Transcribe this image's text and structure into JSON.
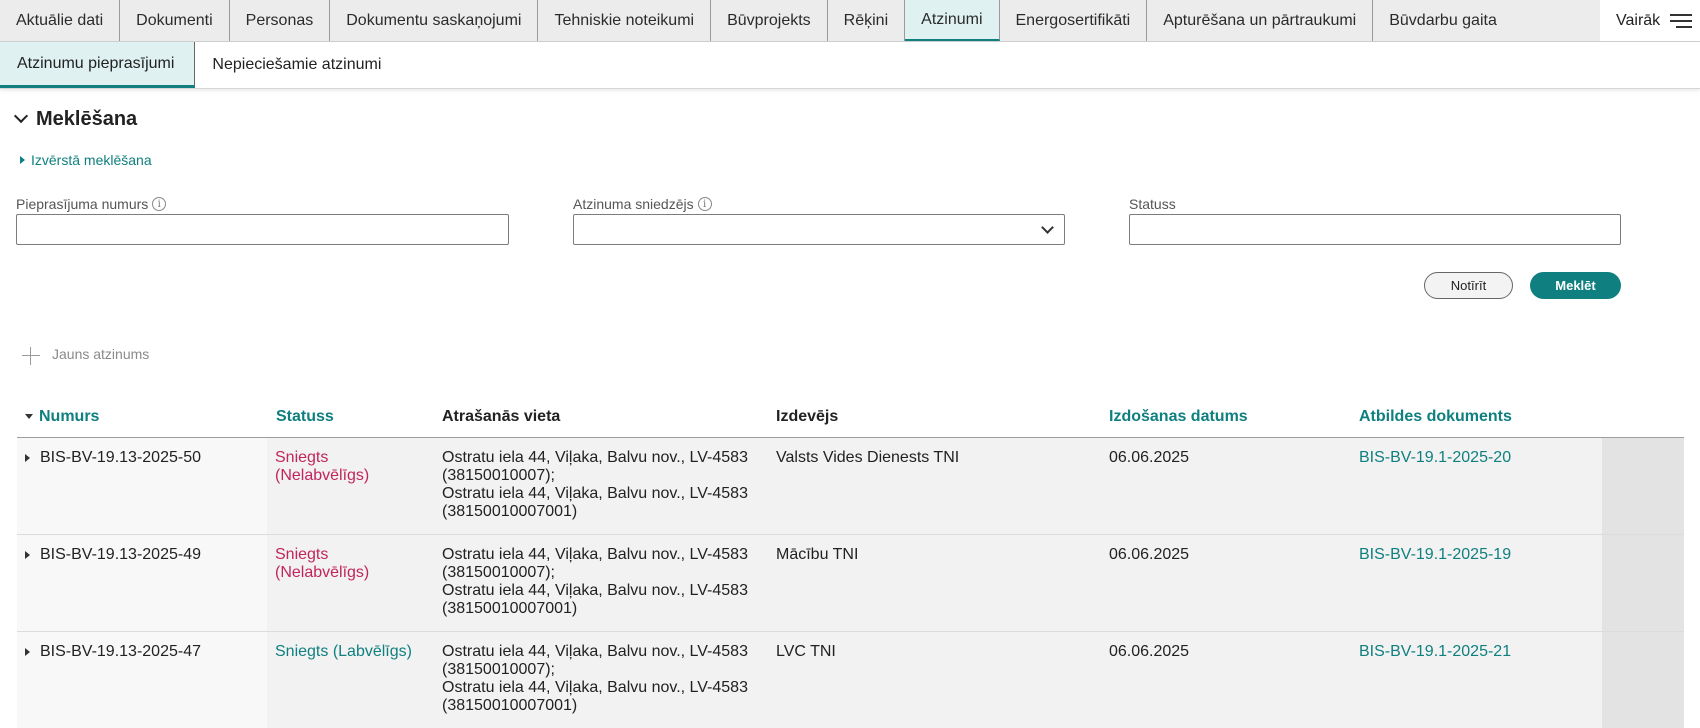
{
  "top_tabs": [
    {
      "label": "Aktuālie dati"
    },
    {
      "label": "Dokumenti"
    },
    {
      "label": "Personas"
    },
    {
      "label": "Dokumentu saskaņojumi"
    },
    {
      "label": "Tehniskie noteikumi"
    },
    {
      "label": "Būvprojekts"
    },
    {
      "label": "Rēķini"
    },
    {
      "label": "Atzinumi",
      "active": true
    },
    {
      "label": "Energosertifikāti"
    },
    {
      "label": "Apturēšana un pārtraukumi"
    },
    {
      "label": "Būvdarbu gaita"
    }
  ],
  "more_label": "Vairāk",
  "sub_tabs": [
    {
      "label": "Atzinumu pieprasījumi",
      "active": true
    },
    {
      "label": "Nepieciešamie atzinumi"
    }
  ],
  "search": {
    "title": "Meklēšana",
    "advanced_label": "Izvērstā meklēšana",
    "fields": {
      "request_number_label": "Pieprasījuma numurs",
      "issuer_label": "Atzinuma sniedzējs",
      "status_label": "Statuss"
    },
    "clear_label": "Notīrīt",
    "search_label": "Meklēt"
  },
  "new_label": "Jauns atzinums",
  "table": {
    "headers": {
      "number": "Numurs",
      "status": "Statuss",
      "location": "Atrašanās vieta",
      "issuer": "Izdevējs",
      "issue_date": "Izdošanas datums",
      "response_doc": "Atbildes dokuments"
    },
    "rows": [
      {
        "number": "BIS-BV-19.13-2025-50",
        "status_line1": "Sniegts",
        "status_line2": "(Nelabvēlīgs)",
        "location": [
          "Ostratu iela 44, Viļaka, Balvu nov., LV-4583",
          "(38150010007);",
          "Ostratu iela 44, Viļaka, Balvu nov., LV-4583",
          "(38150010007001)"
        ],
        "issuer": "Valsts Vides Dienests TNI",
        "issue_date": "06.06.2025",
        "response_doc": "BIS-BV-19.1-2025-20"
      },
      {
        "number": "BIS-BV-19.13-2025-49",
        "status_line1": "Sniegts",
        "status_line2": "(Nelabvēlīgs)",
        "location": [
          "Ostratu iela 44, Viļaka, Balvu nov., LV-4583",
          "(38150010007);",
          "Ostratu iela 44, Viļaka, Balvu nov., LV-4583",
          "(38150010007001)"
        ],
        "issuer": "Mācību TNI",
        "issue_date": "06.06.2025",
        "response_doc": "BIS-BV-19.1-2025-19"
      },
      {
        "number": "BIS-BV-19.13-2025-47",
        "status_line1": "Sniegts (Labvēlīgs)",
        "status_line2": "",
        "location": [
          "Ostratu iela 44, Viļaka, Balvu nov., LV-4583",
          "(38150010007);",
          "Ostratu iela 44, Viļaka, Balvu nov., LV-4583",
          "(38150010007001)"
        ],
        "issuer": "LVC TNI",
        "issue_date": "06.06.2025",
        "response_doc": "BIS-BV-19.1-2025-21"
      }
    ]
  },
  "colors": {
    "accent": "#0f7f7f",
    "negative_status": "#c2255c",
    "active_tab_bg": "#dff1f1"
  },
  "icons": {
    "collapse": "chevron-down-icon",
    "expand_row": "caret-right-icon",
    "info": "info-icon",
    "menu": "hamburger-icon",
    "add": "plus-icon"
  }
}
